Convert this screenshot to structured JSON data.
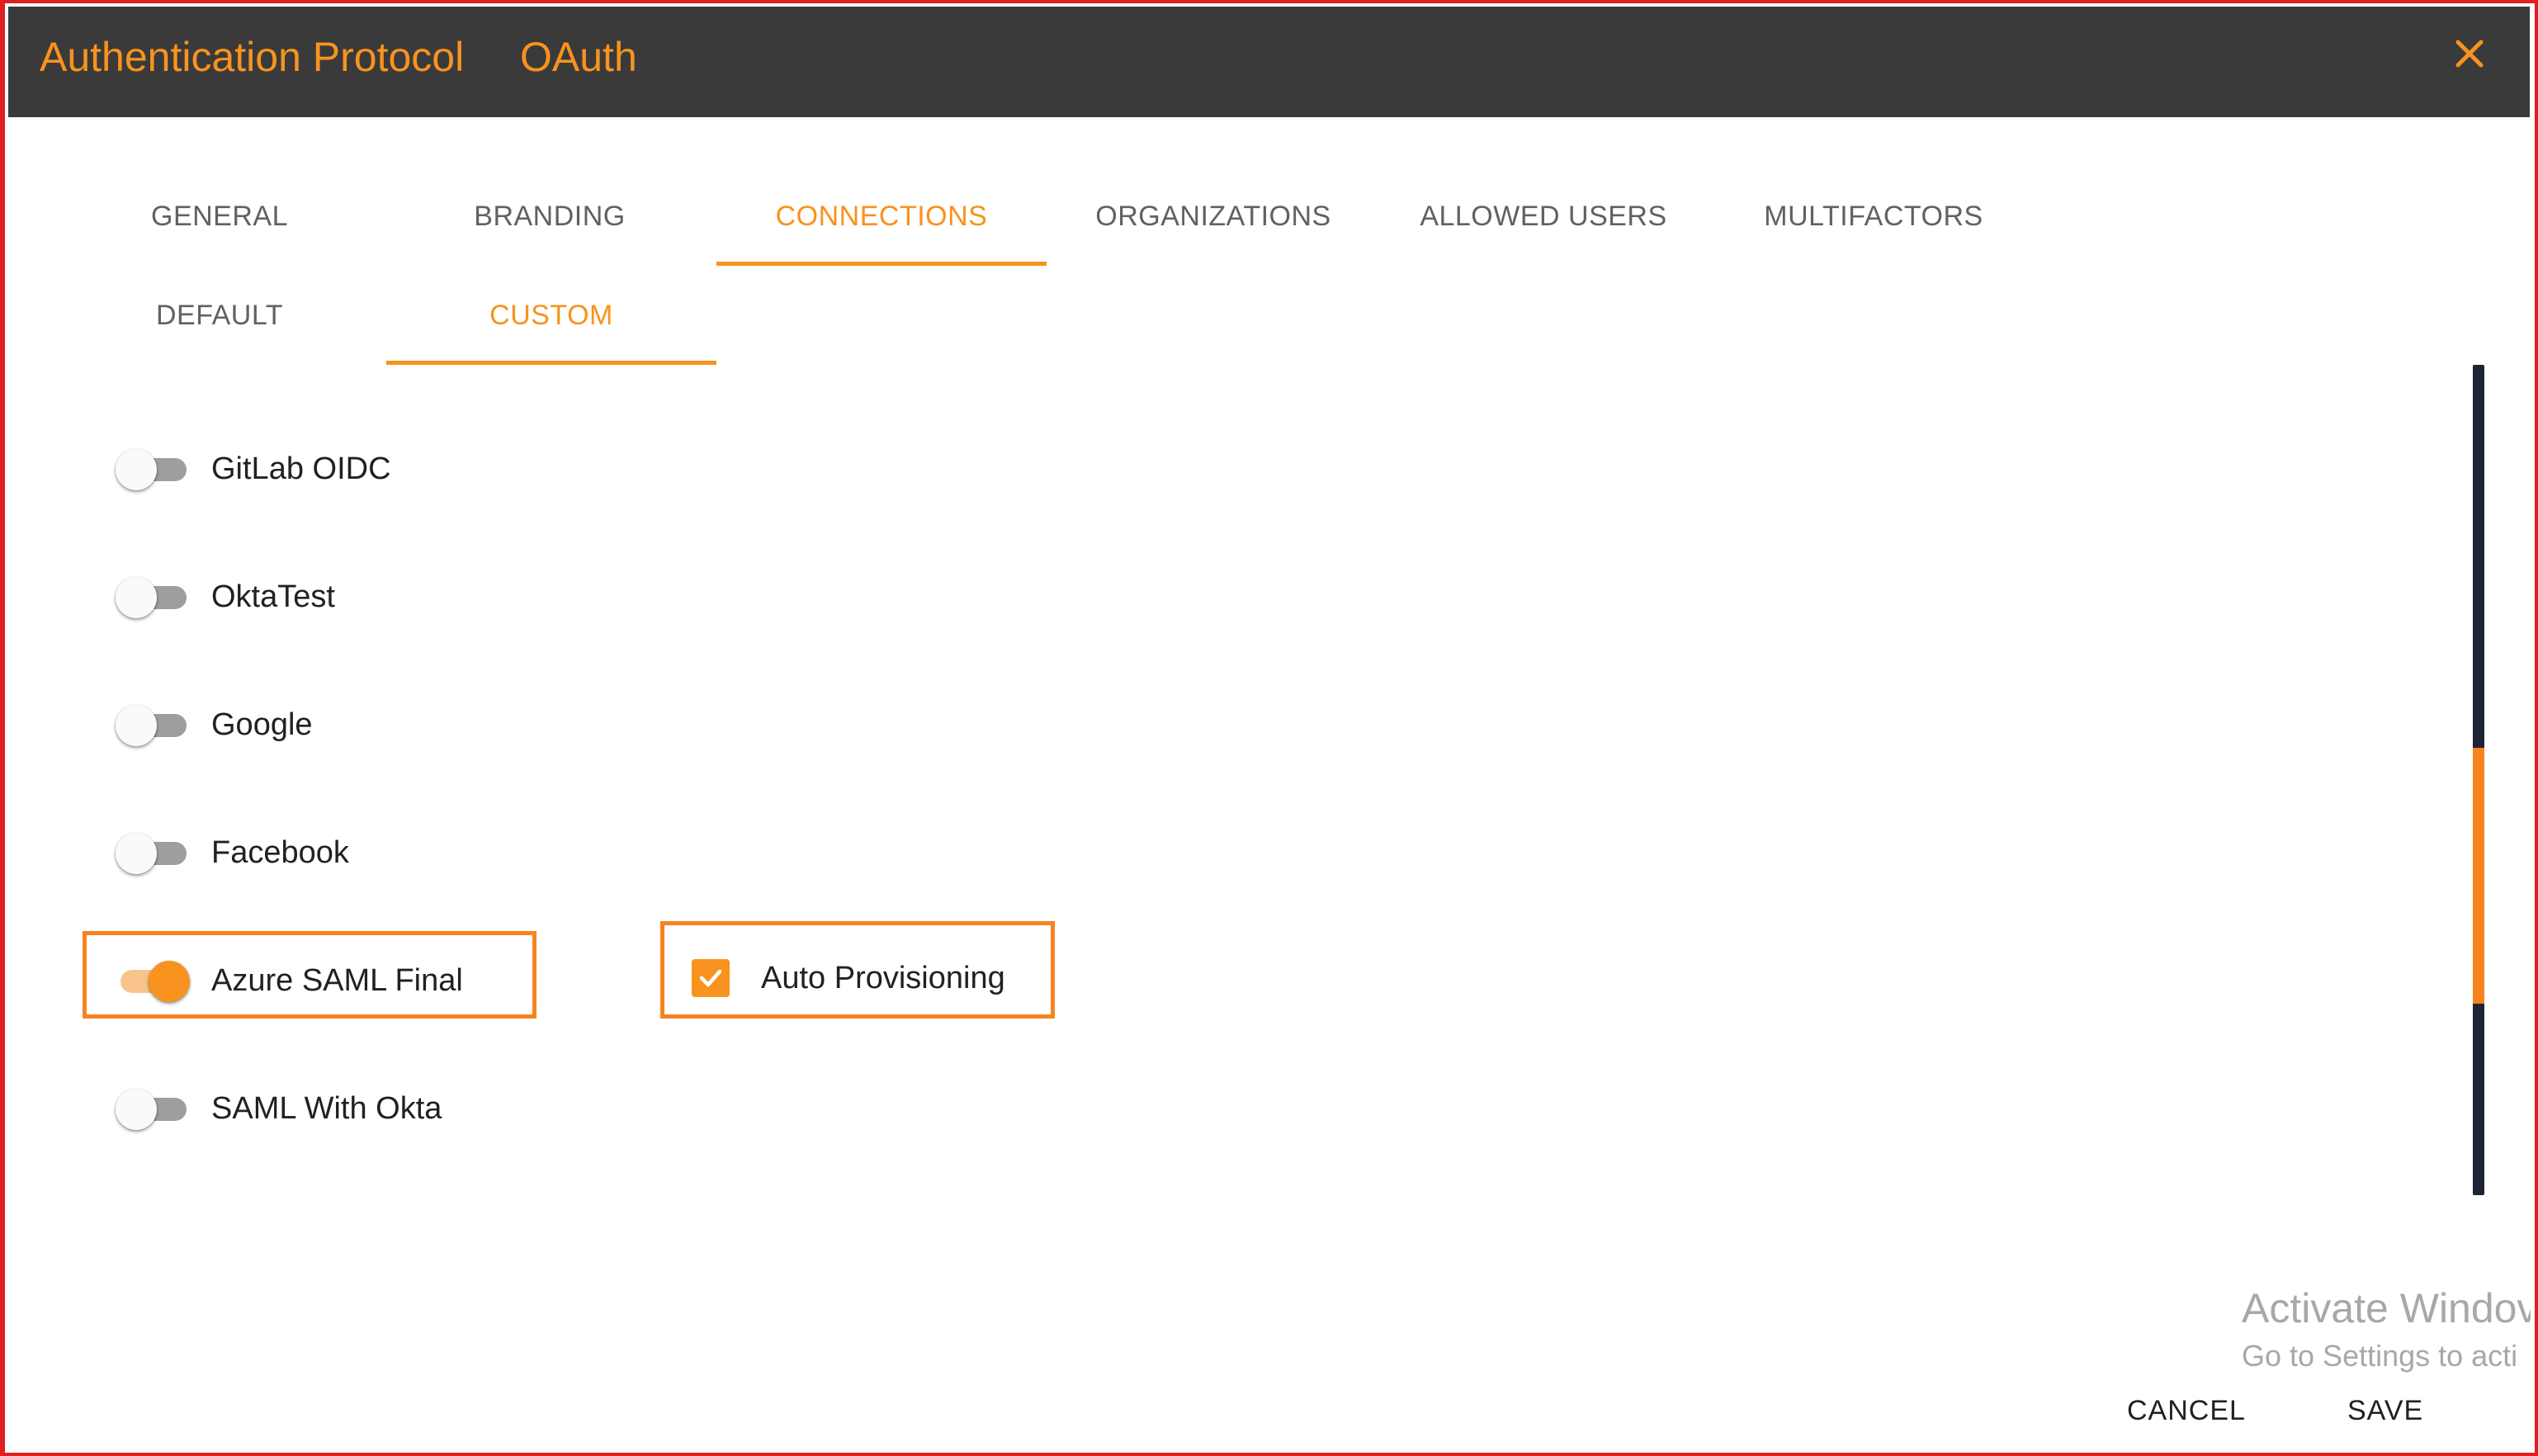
{
  "header": {
    "title": "Authentication Protocol",
    "protocol": "OAuth",
    "close_icon": "close-icon"
  },
  "tabs": [
    {
      "label": "GENERAL",
      "active": false
    },
    {
      "label": "BRANDING",
      "active": false
    },
    {
      "label": "CONNECTIONS",
      "active": true
    },
    {
      "label": "ORGANIZATIONS",
      "active": false
    },
    {
      "label": "ALLOWED USERS",
      "active": false
    },
    {
      "label": "MULTIFACTORS",
      "active": false
    }
  ],
  "subtabs": [
    {
      "label": "DEFAULT",
      "active": false
    },
    {
      "label": "CUSTOM",
      "active": true
    }
  ],
  "connections": [
    {
      "label": "GitLab OIDC",
      "enabled": false
    },
    {
      "label": "OktaTest",
      "enabled": false
    },
    {
      "label": "Google",
      "enabled": false
    },
    {
      "label": "Facebook",
      "enabled": false
    },
    {
      "label": "Azure SAML Final",
      "enabled": true
    },
    {
      "label": "SAML With Okta",
      "enabled": false
    }
  ],
  "auto_provisioning": {
    "label": "Auto Provisioning",
    "checked": true
  },
  "watermark": {
    "line1": "Activate Windov",
    "line2": "Go to Settings to acti"
  },
  "footer": {
    "cancel_label": "CANCEL",
    "save_label": "SAVE"
  },
  "colors": {
    "accent": "#f7931e",
    "header_bg": "#3a3a3a",
    "highlight_border": "#f7831e",
    "frame_border": "#e02020"
  }
}
